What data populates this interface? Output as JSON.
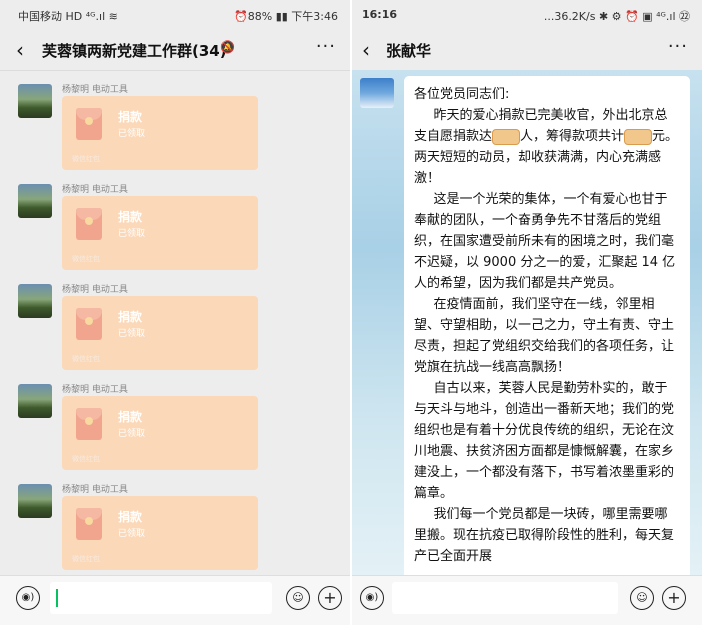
{
  "left": {
    "status": {
      "carrier": "中国移动",
      "signal": "HD ⁴ᴳ.ıl ≋",
      "battery": "⏰88% ▮▮ 下午3:46"
    },
    "title": "芙蓉镇两新党建工作群(34)",
    "messages": [
      {
        "sender": "杨黎明 电动工具",
        "title": "捐款",
        "status": "已领取",
        "footer": "微信红包"
      },
      {
        "sender": "杨黎明 电动工具",
        "title": "捐款",
        "status": "已领取",
        "footer": "微信红包"
      },
      {
        "sender": "杨黎明 电动工具",
        "title": "捐款",
        "status": "已领取",
        "footer": "微信红包"
      },
      {
        "sender": "杨黎明 电动工具",
        "title": "捐款",
        "status": "已领取",
        "footer": "微信红包"
      },
      {
        "sender": "杨黎明 电动工具",
        "title": "捐款",
        "status": "已领取",
        "footer": "微信红包"
      }
    ]
  },
  "right": {
    "status": {
      "time": "16:16",
      "info": "...36.2K/s ✱ ⚙ ⏰ ▣ ⁴ᴳ.ıl ㉒"
    },
    "title": "张献华",
    "message": {
      "greeting": "各位党员同志们:",
      "p1a": "昨天的爱心捐款已完美收官，外出北京总支自愿捐款达",
      "p1b": "人，筹得款项共计",
      "p1c": "元。两天短短的动员，却收获满满，内心充满感激！",
      "p2": "这是一个光荣的集体，一个有爱心也甘于奉献的团队，一个奋勇争先不甘落后的党组织，在国家遭受前所未有的困境之时，我们毫不迟疑，以 9000 分之一的爱，汇聚起 14 亿人的希望，因为我们都是共产党员。",
      "p3": "在疫情面前，我们坚守在一线，邻里相望、守望相助，以一己之力，守土有责、守土尽责，担起了党组织交给我们的各项任务，让党旗在抗战一线高高飘扬！",
      "p4": "自古以来，芙蓉人民是勤劳朴实的，敢于与天斗与地斗，创造出一番新天地；我们的党组织也是有着十分优良传统的组织，无论在汶川地震、扶贫济困方面都是慷慨解囊，在家乡建没上，一个都没有落下，书写着浓墨重彩的篇章。",
      "p5": "我们每一个党员都是一块砖，哪里需要哪里搬。现在抗疫已取得阶段性的胜利，每天复产已全面开展"
    }
  },
  "icons": {
    "back": "‹",
    "more": "···",
    "mute": "🔕",
    "voice": "◉)",
    "emoji": "☺",
    "plus": "+"
  }
}
